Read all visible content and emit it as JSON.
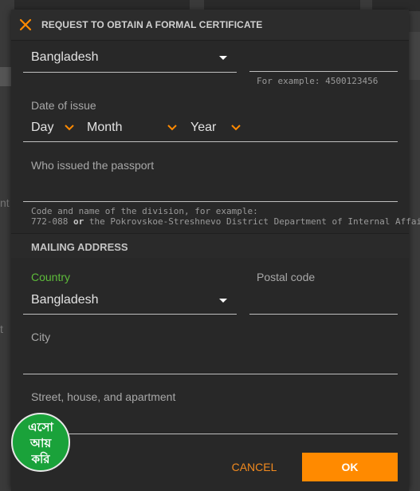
{
  "background": {
    "cards": [
      "",
      "",
      ""
    ],
    "side_fragments": [
      "nt",
      "nt",
      "t"
    ]
  },
  "dialog": {
    "title": "REQUEST TO OBTAIN A FORMAL CERTIFICATE",
    "close_icon": "close-x-icon",
    "accent_color": "#ff8a00"
  },
  "passport": {
    "country_value": "Bangladesh",
    "number_value": "",
    "number_hint": "For example: 4500123456",
    "date_label": "Date of issue",
    "day_placeholder": "Day",
    "month_placeholder": "Month",
    "year_placeholder": "Year",
    "issuer_label": "Who issued the passport",
    "issuer_hint_line1": "Code and name of the division, for example:",
    "issuer_hint_code": "772-088",
    "issuer_hint_or": "or",
    "issuer_hint_rest": "the Pokrovskoe-Streshnevo District Department of Internal Affairs"
  },
  "mailing": {
    "section_title": "MAILING ADDRESS",
    "country_label": "Country",
    "country_value": "Bangladesh",
    "postal_label": "Postal code",
    "city_label": "City",
    "street_label": "Street, house, and apartment"
  },
  "footer": {
    "cancel_label": "CANCEL",
    "ok_label": "OK"
  },
  "watermark": {
    "line1": "এসো",
    "line2": "আয়",
    "line3": "করি"
  }
}
